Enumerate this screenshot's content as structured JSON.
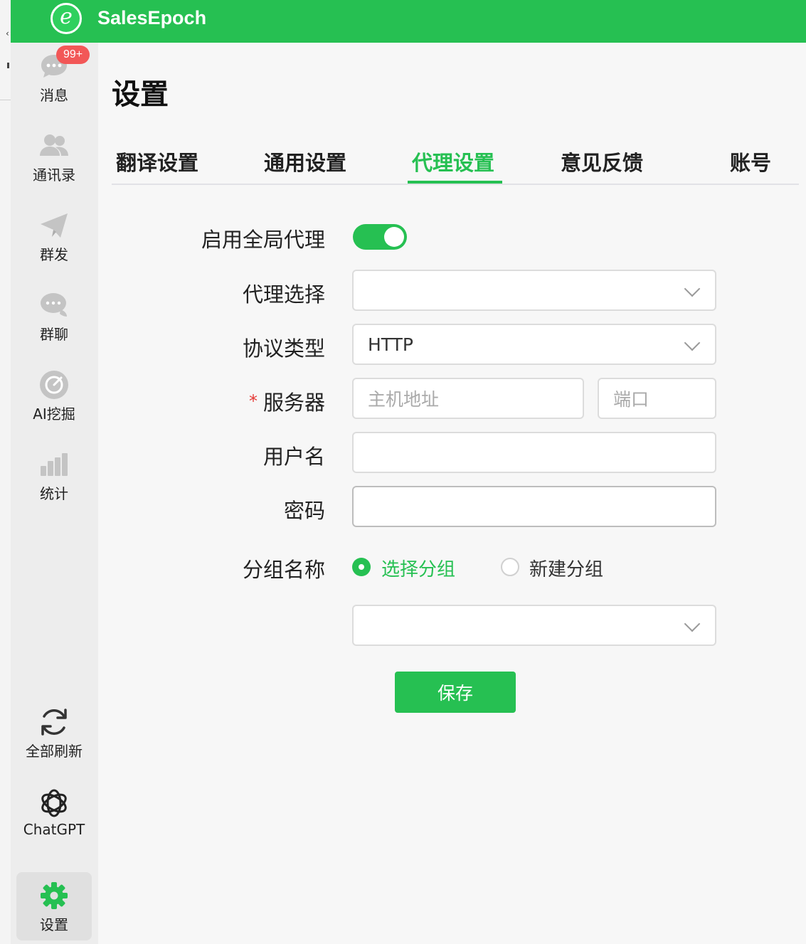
{
  "app": {
    "brand": "SalesEpoch",
    "logo_letter": "e",
    "accent_color": "#26c052"
  },
  "sidebar": {
    "items": [
      {
        "label": "消息",
        "icon": "chat-bubble-icon",
        "badge": "99+"
      },
      {
        "label": "通讯录",
        "icon": "contacts-icon"
      },
      {
        "label": "群发",
        "icon": "send-plane-icon"
      },
      {
        "label": "群聊",
        "icon": "group-chat-icon"
      },
      {
        "label": "AI挖掘",
        "icon": "ai-mining-icon"
      },
      {
        "label": "统计",
        "icon": "bar-chart-icon"
      },
      {
        "label": "全部刷新",
        "icon": "refresh-icon"
      },
      {
        "label": "ChatGPT",
        "icon": "chatgpt-icon"
      },
      {
        "label": "设置",
        "icon": "gear-icon",
        "active": true
      }
    ]
  },
  "page": {
    "title": "设置",
    "tabs": [
      {
        "label": "翻译设置"
      },
      {
        "label": "通用设置"
      },
      {
        "label": "代理设置",
        "active": true
      },
      {
        "label": "意见反馈"
      },
      {
        "label": "账号"
      }
    ]
  },
  "form": {
    "enable_proxy": {
      "label": "启用全局代理",
      "value": true
    },
    "proxy_select": {
      "label": "代理选择",
      "value": ""
    },
    "protocol": {
      "label": "协议类型",
      "value": "HTTP"
    },
    "server": {
      "label": "服务器",
      "required_mark": "*",
      "host_placeholder": "主机地址",
      "port_placeholder": "端口"
    },
    "username": {
      "label": "用户名",
      "value": ""
    },
    "password": {
      "label": "密码",
      "value": ""
    },
    "group": {
      "label": "分组名称",
      "options": [
        {
          "label": "选择分组",
          "selected": true
        },
        {
          "label": "新建分组",
          "selected": false
        }
      ],
      "select_value": ""
    },
    "save_label": "保存"
  }
}
